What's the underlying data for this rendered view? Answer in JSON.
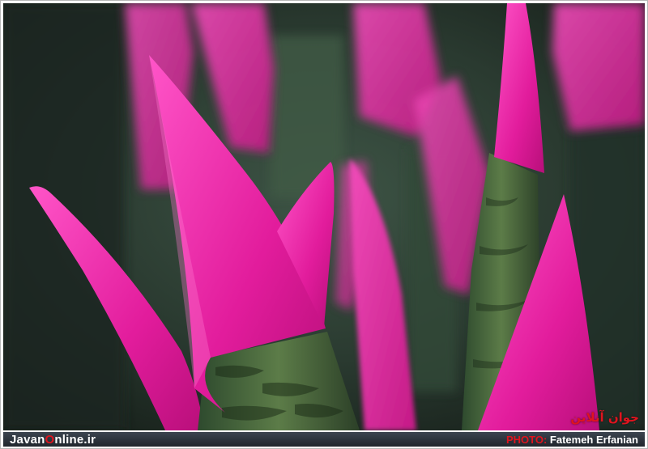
{
  "photo": {
    "subject": "Magenta Sansevieria leaf tips",
    "colors": {
      "background": "#1e2a22",
      "leaf_pink": "#e01e9c",
      "leaf_highlight": "#ff5cc8",
      "stem_green": "#4a6a3e"
    }
  },
  "footer": {
    "brand_prefix": "Javan",
    "brand_o": "O",
    "brand_suffix": "nline.ir",
    "photo_label": "PHOTO:",
    "photographer": "Fatemeh Erfanian"
  },
  "watermark": {
    "text": "جوان آنلاین"
  }
}
